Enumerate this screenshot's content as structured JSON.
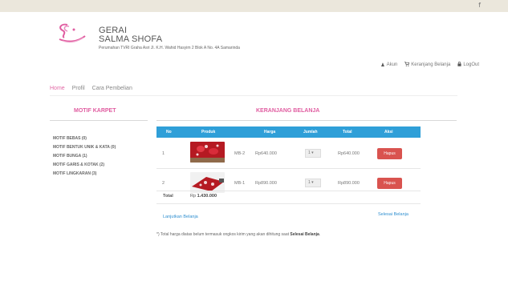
{
  "topbar": {
    "social_icon": "f"
  },
  "brand": {
    "line1": "GERAI",
    "line2": "SALMA SHOFA",
    "address": "Perumahan TVRI Graha Asri Jl. K.H. Wahid Hasyim 2 Blok A No. 4A Samarinda",
    "logo_color": "#e05ca0"
  },
  "usernav": [
    {
      "icon": "user-icon",
      "glyph": "♟",
      "label": "Akun"
    },
    {
      "icon": "cart-icon",
      "glyph": "🛒",
      "label": "Keranjang Belanja"
    },
    {
      "icon": "lock-icon",
      "glyph": "🔒",
      "label": "LogOut"
    }
  ],
  "mainnav": [
    "Home",
    "Profil",
    "Cara Pembelian"
  ],
  "sidebar": {
    "title": "MOTIF KARPET",
    "items": [
      "MOTIF BEBAS (0)",
      "MOTIF BENTUK UNIK & KATA (0)",
      "MOTIF BUNGA (1)",
      "MOTIF GARIS & KOTAK (2)",
      "MOTIF LINGKARAN (3)"
    ]
  },
  "cart": {
    "title": "KERANJANG BELANJA",
    "columns": [
      "No",
      "Produk",
      "Harga",
      "Jumlah",
      "Total",
      "Aksi"
    ],
    "rows": [
      {
        "no": "1",
        "code": "MB-2",
        "price": "Rp640.000",
        "qty": "1",
        "total": "Rp640.000",
        "action": "Hapus"
      },
      {
        "no": "2",
        "code": "MB-1",
        "price": "Rp890.000",
        "qty": "1",
        "total": "Rp890.000",
        "action": "Hapus"
      }
    ],
    "total_label": "Total",
    "total_prefix": "Rp",
    "total_value": "1.430.000",
    "continue_link": "Lanjutkan Belanja",
    "finish_link": "Selesai Belanja",
    "header_color": "#2f9fd8",
    "delete_color": "#d9534f"
  },
  "footnote": {
    "text": "*) Total harga diatas belum termasuk ongkos kirim yang akan dihitung saat ",
    "bold": "Selesai Belanja",
    "end": "."
  }
}
